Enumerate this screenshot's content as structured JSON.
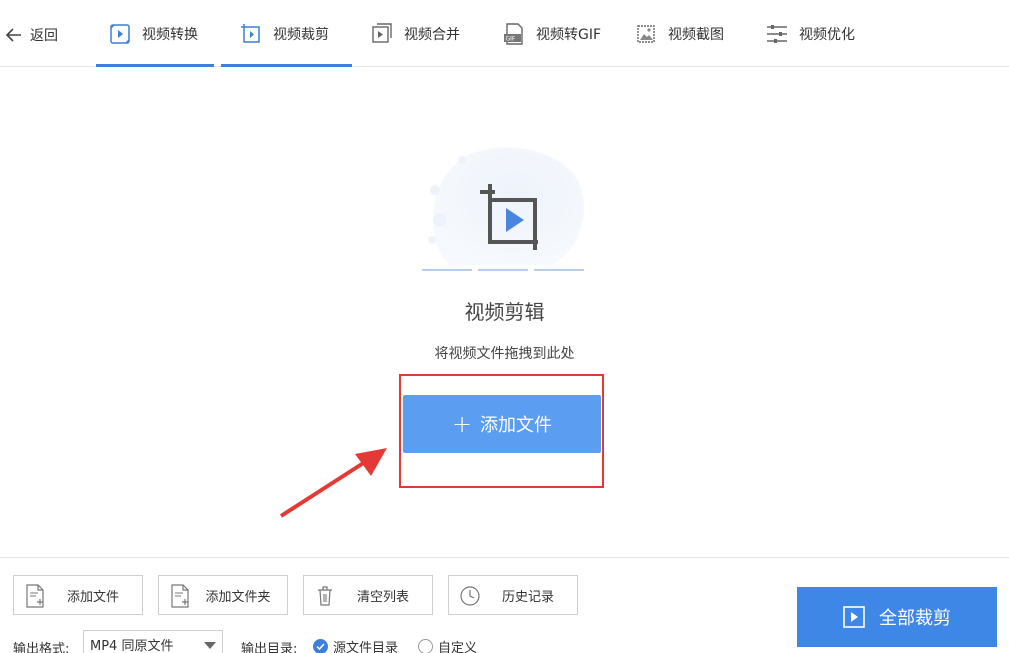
{
  "nav": {
    "back_label": "返回",
    "tabs": [
      {
        "label": "视频转换",
        "icon": "video-convert-icon"
      },
      {
        "label": "视频裁剪",
        "icon": "video-crop-icon"
      },
      {
        "label": "视频合并",
        "icon": "video-merge-icon"
      },
      {
        "label": "视频转GIF",
        "icon": "video-gif-icon"
      },
      {
        "label": "视频截图",
        "icon": "video-screenshot-icon"
      },
      {
        "label": "视频优化",
        "icon": "video-optimize-icon"
      }
    ],
    "gif_badge": "GIF"
  },
  "drop": {
    "title": "视频剪辑",
    "hint": "将视频文件拖拽到此处",
    "add_button": "添加文件",
    "plus": "+"
  },
  "toolbar": {
    "add_file": "添加文件",
    "add_folder": "添加文件夹",
    "clear_list": "清空列表",
    "history": "历史记录",
    "start_all": "全部裁剪"
  },
  "output": {
    "format_label": "输出格式:",
    "format_value": "MP4 同原文件",
    "dir_label": "输出目录:",
    "dir_source": "源文件目录",
    "dir_custom": "自定义",
    "dir_source_checked": true
  },
  "colors": {
    "accent": "#3e7fd8",
    "button_blue": "#5b9df0",
    "start_blue": "#3e87e6",
    "annotation_red": "#e53935"
  }
}
